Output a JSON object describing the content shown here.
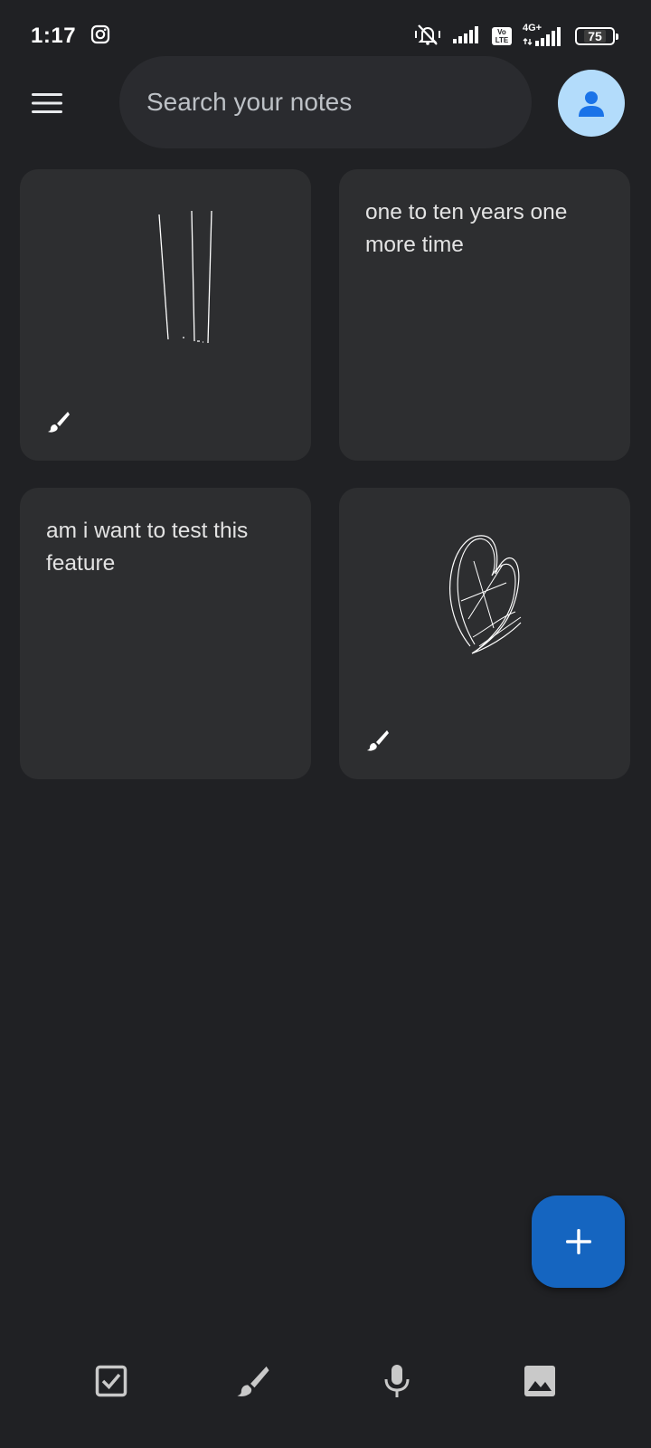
{
  "status_bar": {
    "time": "1:17",
    "battery": "75",
    "volte_top": "Vo",
    "volte_bottom": "LTE",
    "network": "4G+",
    "icons": [
      "instagram-icon",
      "vibrate-silent-icon",
      "signal-icon",
      "volte-icon",
      "signal-4g-icon",
      "battery-icon"
    ]
  },
  "top_bar": {
    "menu_icon": "hamburger-menu-icon",
    "search_placeholder": "Search your notes",
    "avatar_icon": "account-icon"
  },
  "notes": [
    {
      "type": "drawing",
      "badge_icon": "brush-icon"
    },
    {
      "type": "text",
      "text": "one to ten years one more time"
    },
    {
      "type": "text",
      "text": "am i want to test this feature"
    },
    {
      "type": "drawing",
      "badge_icon": "brush-icon"
    }
  ],
  "fab": {
    "icon": "plus-icon"
  },
  "bottom_bar": {
    "actions": [
      {
        "icon": "checkbox-icon",
        "name": "new-list"
      },
      {
        "icon": "brush-icon",
        "name": "new-drawing"
      },
      {
        "icon": "microphone-icon",
        "name": "new-audio"
      },
      {
        "icon": "image-icon",
        "name": "new-image"
      }
    ]
  },
  "colors": {
    "background": "#202124",
    "card": "#2d2e30",
    "search": "#2a2b2f",
    "fab": "#1565c0",
    "avatar_bg": "#b3dcfb",
    "avatar_fg": "#1a73e8"
  }
}
